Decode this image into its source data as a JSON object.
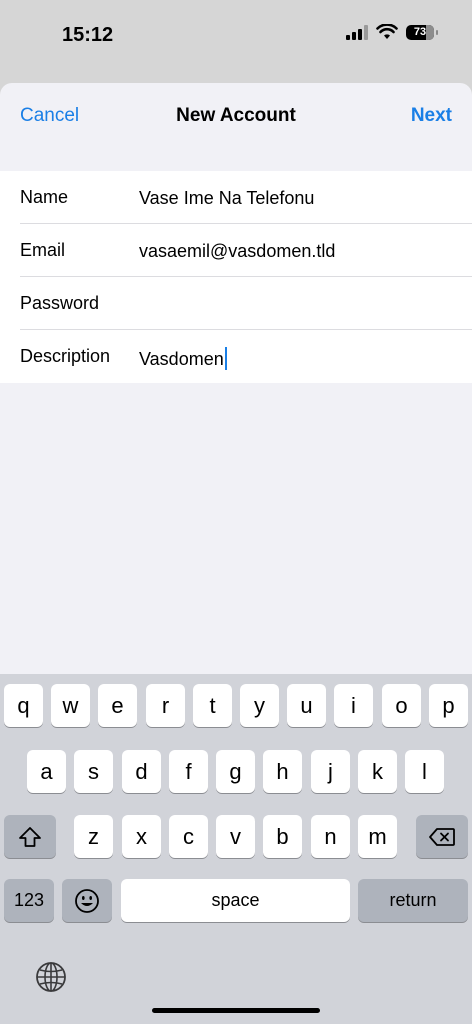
{
  "status": {
    "time": "15:12",
    "battery": "73"
  },
  "nav": {
    "cancel": "Cancel",
    "title": "New Account",
    "next": "Next"
  },
  "form": {
    "rows": [
      {
        "label": "Name",
        "value": "Vase Ime Na Telefonu"
      },
      {
        "label": "Email",
        "value": "vasaemil@vasdomen.tld"
      },
      {
        "label": "Password",
        "value": ""
      },
      {
        "label": "Description",
        "value": "Vasdomen"
      }
    ]
  },
  "keyboard": {
    "row1": [
      "q",
      "w",
      "e",
      "r",
      "t",
      "y",
      "u",
      "i",
      "o",
      "p"
    ],
    "row2": [
      "a",
      "s",
      "d",
      "f",
      "g",
      "h",
      "j",
      "k",
      "l"
    ],
    "row3": [
      "z",
      "x",
      "c",
      "v",
      "b",
      "n",
      "m"
    ],
    "numbers": "123",
    "space": "space",
    "return": "return",
    "icons": [
      "shift-icon",
      "backspace-icon",
      "emoji-icon",
      "globe-icon"
    ]
  }
}
